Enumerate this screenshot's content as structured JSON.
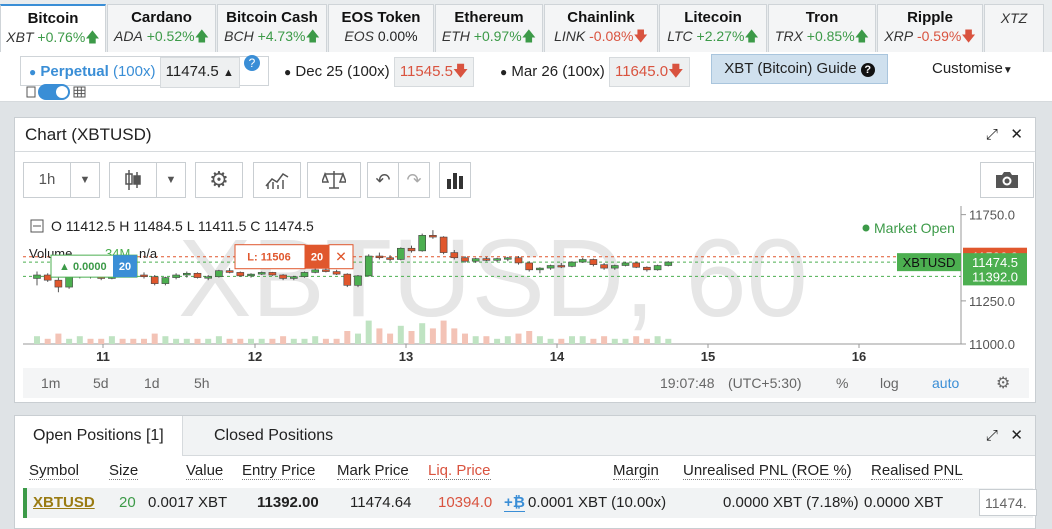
{
  "tickers": [
    {
      "name": "Bitcoin",
      "symbol": "XBT",
      "change": "+0.76%",
      "dir": "up",
      "arrow": "🡅",
      "width": 106,
      "active": true
    },
    {
      "name": "Cardano",
      "symbol": "ADA",
      "change": "+0.52%",
      "dir": "up",
      "arrow": "🡅",
      "width": 109
    },
    {
      "name": "Bitcoin Cash",
      "symbol": "BCH",
      "change": "+4.73%",
      "dir": "up",
      "arrow": "🡅",
      "width": 110
    },
    {
      "name": "EOS Token",
      "symbol": "EOS",
      "change": "0.00%",
      "dir": "flat",
      "arrow": "",
      "width": 106
    },
    {
      "name": "Ethereum",
      "symbol": "ETH",
      "change": "+0.97%",
      "dir": "up",
      "arrow": "🡅",
      "width": 108
    },
    {
      "name": "Chainlink",
      "symbol": "LINK",
      "change": "-0.08%",
      "dir": "dn",
      "arrow": "🡇",
      "width": 114
    },
    {
      "name": "Litecoin",
      "symbol": "LTC",
      "change": "+2.27%",
      "dir": "up",
      "arrow": "🡅",
      "width": 108
    },
    {
      "name": "Tron",
      "symbol": "TRX",
      "change": "+0.85%",
      "dir": "up",
      "arrow": "🡅",
      "width": 108
    },
    {
      "name": "Ripple",
      "symbol": "XRP",
      "change": "-0.59%",
      "dir": "dn",
      "arrow": "🡇",
      "width": 106
    },
    {
      "name": "",
      "symbol": "XTZ",
      "change": "",
      "dir": "flat",
      "arrow": "",
      "width": 60
    }
  ],
  "contracts": {
    "perpetual": {
      "label": "Perpetual",
      "leverage": "(100x)",
      "price": "11474.5",
      "arrow": "▲",
      "help": "?"
    },
    "dec": {
      "label": "Dec 25 (100x)",
      "price": "11545.5",
      "arrow": "🡇"
    },
    "mar": {
      "label": "Mar 26 (100x)",
      "price": "11645.0",
      "arrow": "🡇"
    },
    "guide": "XBT (Bitcoin) Guide",
    "customise": "Customise"
  },
  "chart_panel": {
    "title": "Chart (XBTUSD)",
    "interval": "1h",
    "ohlc": {
      "o": "11412.5",
      "h": "11484.5",
      "l": "11411.5",
      "c": "11474.5"
    },
    "volume": "Volume",
    "volume_value": "34M",
    "volume_na": "n/a",
    "market_status": "Market Open",
    "watermark": "XBTUSD, 60",
    "order_badge": {
      "label": "L: 11506",
      "qty": "20"
    },
    "position_badge": {
      "label": "▲ 0.0000",
      "qty": "20"
    },
    "price_tags": [
      {
        "label": "11506.0",
        "color": "#e0572d",
        "text": "#fff"
      },
      {
        "label": "11474.5",
        "color": "#4caf50",
        "text": "#fff"
      },
      {
        "label": "11392.0",
        "color": "#4caf50",
        "text": "#fff"
      }
    ],
    "symbol_tag": "XBTUSD",
    "y_ticks": [
      "11750.0",
      "11250.0",
      "11000.0"
    ],
    "x_ticks": [
      "11",
      "12",
      "13",
      "14",
      "15",
      "16"
    ],
    "ranges": [
      "1m",
      "5d",
      "1d",
      "5h"
    ],
    "time": "19:07:48",
    "tz": "(UTC+5:30)",
    "scale_opts": [
      "%",
      "log",
      "auto"
    ]
  },
  "chart_data": {
    "type": "candlestick",
    "title": "",
    "y_ticks": [
      11000,
      11250,
      11750
    ],
    "ylim": [
      11000,
      11800
    ],
    "x_ticks": [
      "11",
      "12",
      "13",
      "14",
      "15",
      "16"
    ],
    "lines": [
      11506.0,
      11474.5,
      11392.0
    ],
    "candles": [
      [
        11380,
        11420,
        11340,
        11400
      ],
      [
        11400,
        11410,
        11360,
        11370
      ],
      [
        11370,
        11385,
        11300,
        11330
      ],
      [
        11330,
        11400,
        11320,
        11390
      ],
      [
        11390,
        11430,
        11380,
        11415
      ],
      [
        11415,
        11420,
        11380,
        11395
      ],
      [
        11395,
        11410,
        11370,
        11380
      ],
      [
        11380,
        11440,
        11375,
        11430
      ],
      [
        11430,
        11450,
        11410,
        11420
      ],
      [
        11420,
        11425,
        11390,
        11400
      ],
      [
        11400,
        11415,
        11380,
        11390
      ],
      [
        11390,
        11400,
        11340,
        11350
      ],
      [
        11350,
        11390,
        11340,
        11385
      ],
      [
        11385,
        11410,
        11375,
        11400
      ],
      [
        11400,
        11420,
        11385,
        11410
      ],
      [
        11410,
        11415,
        11380,
        11385
      ],
      [
        11385,
        11400,
        11370,
        11390
      ],
      [
        11390,
        11430,
        11385,
        11425
      ],
      [
        11425,
        11440,
        11410,
        11415
      ],
      [
        11415,
        11420,
        11390,
        11395
      ],
      [
        11395,
        11410,
        11385,
        11405
      ],
      [
        11405,
        11420,
        11400,
        11415
      ],
      [
        11415,
        11418,
        11395,
        11400
      ],
      [
        11400,
        11405,
        11370,
        11380
      ],
      [
        11380,
        11395,
        11370,
        11390
      ],
      [
        11390,
        11420,
        11385,
        11415
      ],
      [
        11415,
        11440,
        11410,
        11430
      ],
      [
        11430,
        11445,
        11415,
        11420
      ],
      [
        11420,
        11430,
        11400,
        11405
      ],
      [
        11405,
        11410,
        11330,
        11340
      ],
      [
        11340,
        11400,
        11330,
        11395
      ],
      [
        11395,
        11520,
        11390,
        11510
      ],
      [
        11510,
        11530,
        11490,
        11500
      ],
      [
        11500,
        11515,
        11480,
        11490
      ],
      [
        11490,
        11560,
        11485,
        11555
      ],
      [
        11555,
        11570,
        11530,
        11540
      ],
      [
        11540,
        11640,
        11535,
        11630
      ],
      [
        11630,
        11660,
        11610,
        11620
      ],
      [
        11620,
        11625,
        11520,
        11530
      ],
      [
        11530,
        11545,
        11490,
        11500
      ],
      [
        11500,
        11510,
        11470,
        11480
      ],
      [
        11480,
        11500,
        11470,
        11495
      ],
      [
        11495,
        11505,
        11480,
        11485
      ],
      [
        11485,
        11500,
        11475,
        11495
      ],
      [
        11495,
        11505,
        11480,
        11500
      ],
      [
        11500,
        11510,
        11460,
        11470
      ],
      [
        11470,
        11480,
        11420,
        11430
      ],
      [
        11430,
        11445,
        11410,
        11440
      ],
      [
        11440,
        11460,
        11430,
        11455
      ],
      [
        11455,
        11470,
        11440,
        11450
      ],
      [
        11450,
        11480,
        11445,
        11475
      ],
      [
        11475,
        11500,
        11470,
        11490
      ],
      [
        11490,
        11495,
        11450,
        11460
      ],
      [
        11460,
        11470,
        11430,
        11440
      ],
      [
        11440,
        11460,
        11430,
        11455
      ],
      [
        11455,
        11475,
        11450,
        11470
      ],
      [
        11470,
        11478,
        11440,
        11445
      ],
      [
        11445,
        11450,
        11420,
        11430
      ],
      [
        11430,
        11460,
        11425,
        11455
      ],
      [
        11455,
        11480,
        11450,
        11475
      ]
    ],
    "volumes": [
      3,
      2,
      4,
      2,
      3,
      2,
      2,
      3,
      2,
      2,
      2,
      4,
      3,
      2,
      2,
      2,
      2,
      3,
      2,
      2,
      2,
      2,
      2,
      3,
      2,
      2,
      3,
      2,
      2,
      5,
      4,
      9,
      6,
      4,
      7,
      5,
      8,
      6,
      9,
      6,
      4,
      3,
      3,
      2,
      3,
      4,
      5,
      3,
      2,
      2,
      3,
      3,
      2,
      3,
      2,
      2,
      3,
      2,
      3,
      2
    ]
  },
  "positions": {
    "tabs": [
      "Open Positions [1]",
      "Closed Positions"
    ],
    "headers": [
      "Symbol",
      "Size",
      "Value",
      "Entry Price",
      "Mark Price",
      "Liq. Price",
      "Margin",
      "Unrealised PNL (ROE %)",
      "Realised PNL"
    ],
    "row": {
      "symbol": "XBTUSD",
      "size": "20",
      "value": "0.0017 XBT",
      "entry": "11392.00",
      "mark": "11474.64",
      "liq": "10394.0",
      "margin_icon": "+₿",
      "margin": "0.0001 XBT (10.00x)",
      "upnl": "0.0000 XBT (7.18%)",
      "rpnl": "0.0000 XBT",
      "close_input": "11474."
    }
  },
  "colors": {
    "accent": "#3a8ed6",
    "up": "#3c9a48",
    "down": "#d9533f",
    "candle_up": "#4caf50",
    "candle_down": "#e0572d"
  }
}
